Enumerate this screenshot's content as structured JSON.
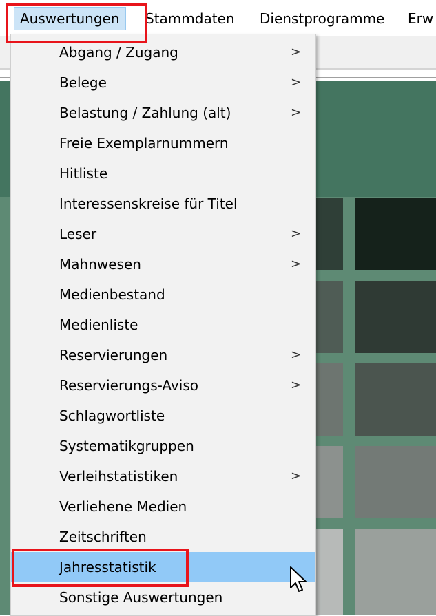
{
  "menubar": {
    "items": [
      {
        "label": "Auswertungen"
      },
      {
        "label": "Stammdaten"
      },
      {
        "label": "Dienstprogramme"
      },
      {
        "label": "Erw"
      }
    ]
  },
  "dropdown": {
    "items": [
      {
        "label": "Abgang / Zugang",
        "submenu": true,
        "arrow": ">"
      },
      {
        "label": "Belege",
        "submenu": true,
        "arrow": ">"
      },
      {
        "label": "Belastung / Zahlung (alt)",
        "submenu": true,
        "arrow": ">"
      },
      {
        "label": "Freie Exemplarnummern",
        "submenu": false
      },
      {
        "label": "Hitliste",
        "submenu": false
      },
      {
        "label": "Interessenskreise für Titel",
        "submenu": false
      },
      {
        "label": "Leser",
        "submenu": true,
        "arrow": ">"
      },
      {
        "label": "Mahnwesen",
        "submenu": true,
        "arrow": ">"
      },
      {
        "label": "Medienbestand",
        "submenu": false
      },
      {
        "label": "Medienliste",
        "submenu": false
      },
      {
        "label": "Reservierungen",
        "submenu": true,
        "arrow": ">"
      },
      {
        "label": "Reservierungs-Aviso",
        "submenu": true,
        "arrow": ">"
      },
      {
        "label": "Schlagwortliste",
        "submenu": false
      },
      {
        "label": "Systematikgruppen",
        "submenu": false
      },
      {
        "label": "Verleihstatistiken",
        "submenu": true,
        "arrow": ">"
      },
      {
        "label": "Verliehene Medien",
        "submenu": false
      },
      {
        "label": "Zeitschriften",
        "submenu": false
      },
      {
        "label": "Jahresstatistik",
        "submenu": false
      },
      {
        "label": "Sonstige Auswertungen",
        "submenu": false
      }
    ]
  },
  "colors": {
    "highlight": "#91c9f7",
    "annotation_red": "#e8141b",
    "menubar_active": "#cce4f7"
  },
  "icons": {
    "cursor": "mouse-pointer-icon",
    "submenu": "chevron-right-icon"
  }
}
